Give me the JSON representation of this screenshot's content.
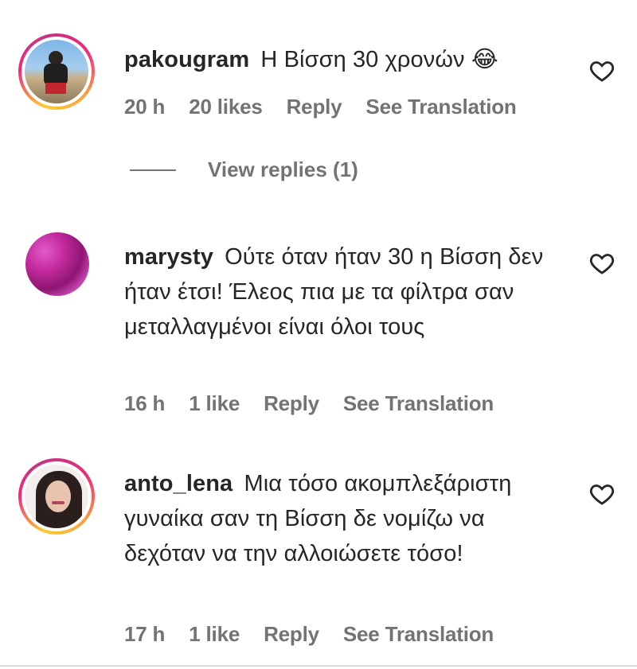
{
  "comments": [
    {
      "username": "pakougram",
      "text": "Η Βίσση 30 χρονών",
      "emoji": "😂",
      "time": "20 h",
      "likes": "20 likes",
      "reply": "Reply",
      "translate": "See Translation",
      "view_replies": "View replies (1)",
      "avatar_ring": true
    },
    {
      "username": "marysty",
      "text": "Ούτε όταν ήταν 30 η Βίσση δεν ήταν έτσι! Έλεος πια με τα φίλτρα σαν μεταλλαγμένοι είναι όλοι τους",
      "time": "16 h",
      "likes": "1 like",
      "reply": "Reply",
      "translate": "See Translation",
      "avatar_ring": false
    },
    {
      "username": "anto_lena",
      "text": "Μια τόσο ακομπλεξάριστη γυναίκα σαν τη Βίσση δε νομίζω να δεχόταν να την αλλοιώσετε τόσο!",
      "time": "17 h",
      "likes": "1 like",
      "reply": "Reply",
      "translate": "See Translation",
      "avatar_ring": true
    }
  ],
  "colors": {
    "text": "#262626",
    "meta": "#737373",
    "ring_start": "#f9ce34",
    "ring_mid": "#ee2a7b",
    "ring_end": "#c13584"
  }
}
